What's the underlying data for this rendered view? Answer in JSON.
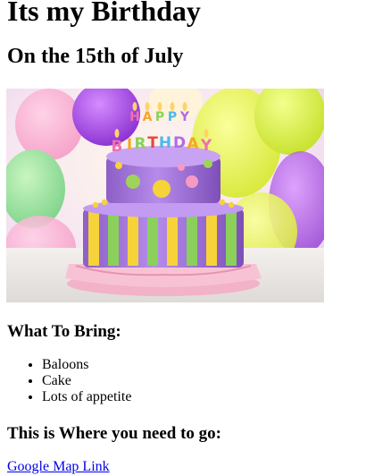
{
  "title": "Its my Birthday",
  "subtitle": "On the 15th of July",
  "hero_image": {
    "cake_sign_top": "HAPPY",
    "cake_sign_bottom": "BIRTHDAY"
  },
  "bring": {
    "heading": "What To Bring:",
    "items": [
      "Baloons",
      "Cake",
      "Lots of appetite"
    ]
  },
  "location": {
    "heading": "This is Where you need to go:",
    "link_label": "Google Map Link"
  },
  "colors": {
    "link": "#0000ee",
    "text": "#000000",
    "background": "#ffffff"
  }
}
